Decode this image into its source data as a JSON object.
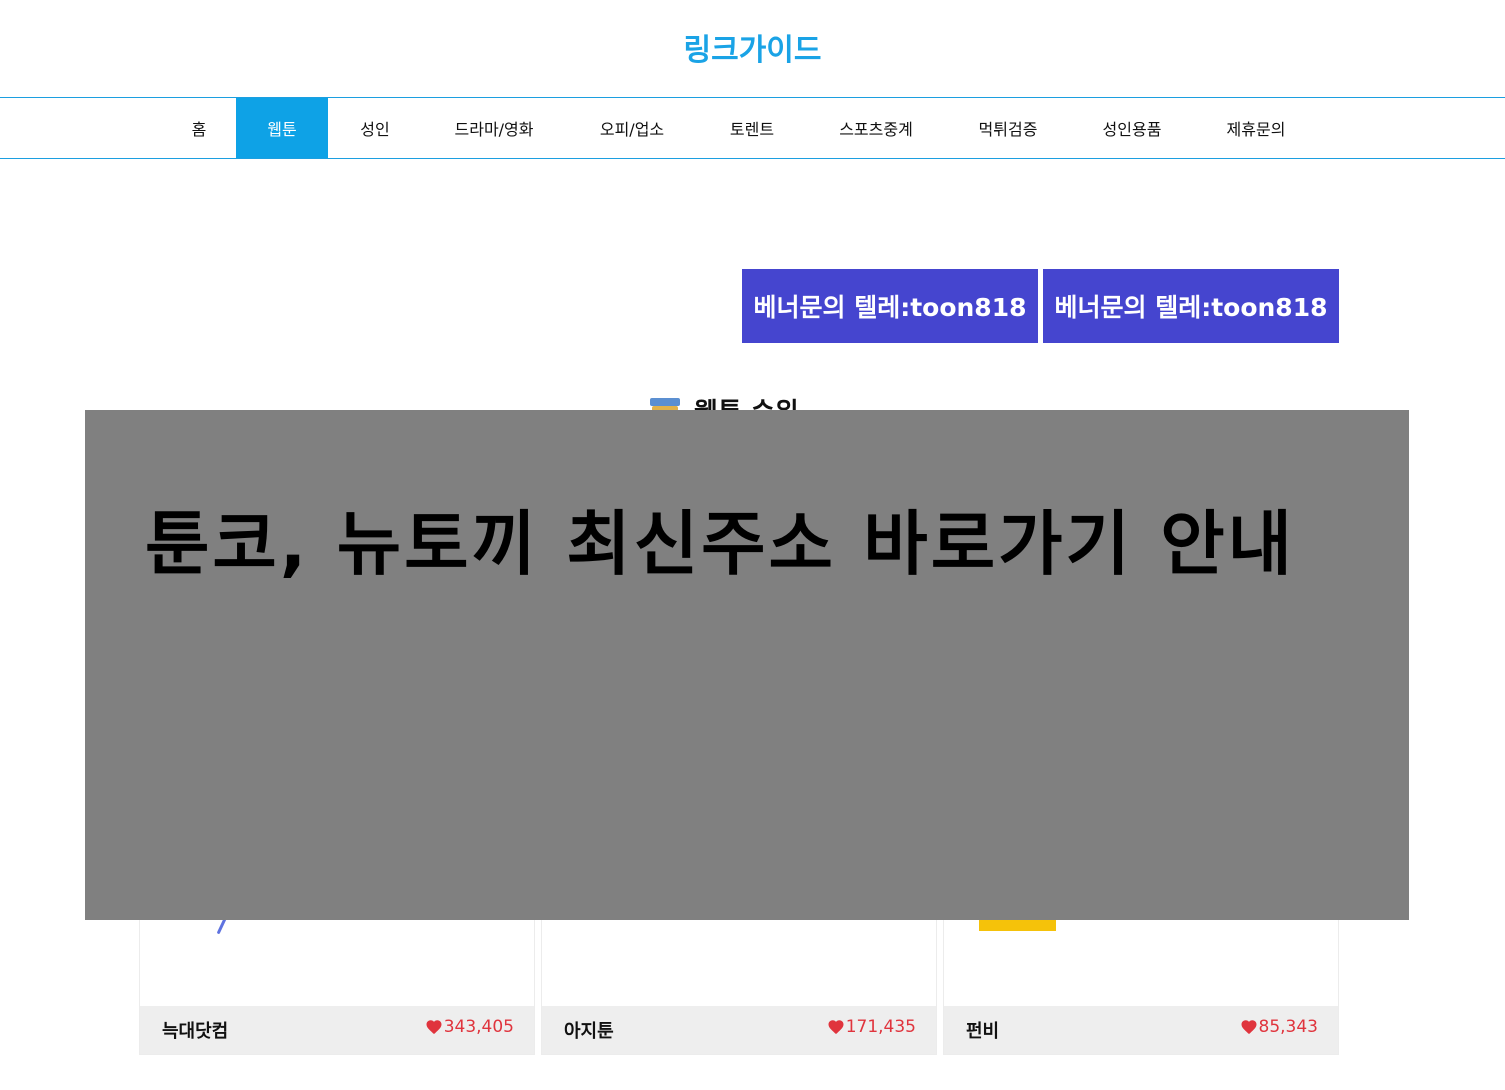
{
  "header": {
    "logo": "링크가이드"
  },
  "nav": {
    "items": [
      {
        "label": "홈",
        "active": false
      },
      {
        "label": "웹툰",
        "active": true
      },
      {
        "label": "성인",
        "active": false
      },
      {
        "label": "드라마/영화",
        "active": false
      },
      {
        "label": "오피/업소",
        "active": false
      },
      {
        "label": "토렌트",
        "active": false
      },
      {
        "label": "스포츠중계",
        "active": false
      },
      {
        "label": "먹튀검증",
        "active": false
      },
      {
        "label": "성인용품",
        "active": false
      },
      {
        "label": "제휴문의",
        "active": false
      }
    ]
  },
  "banners": [
    {
      "label": "베너문의 텔레:toon818"
    },
    {
      "label": "베너문의 텔레:toon818"
    }
  ],
  "section": {
    "title": "웹툰 순위",
    "icon": "book-icon"
  },
  "cards": [
    {
      "name": "늑대닷컴",
      "likes": "343,405"
    },
    {
      "name": "아지툰",
      "likes": "171,435"
    },
    {
      "name": "펀비",
      "likes": "85,343"
    }
  ],
  "overlay": {
    "title": "툰코, 뉴토끼 최신주소 바로가기 안내"
  },
  "colors": {
    "accent": "#0ea2e6",
    "banner": "#4545cf",
    "heart": "#e0343d",
    "overlay": "#808080"
  }
}
